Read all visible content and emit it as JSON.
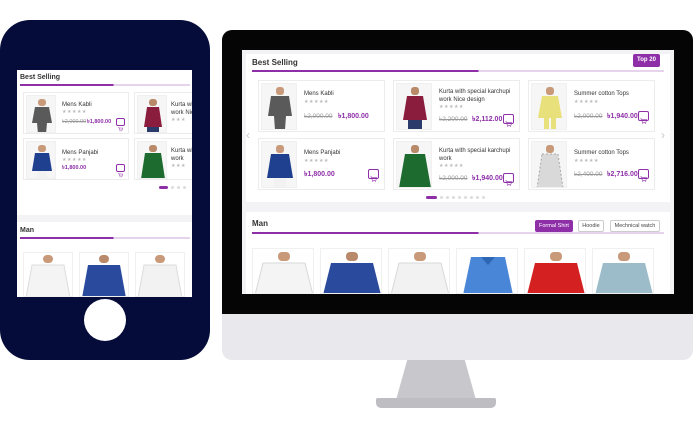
{
  "best_selling": {
    "title": "Best Selling",
    "badge": "Top 20",
    "currency": "৳",
    "cart_icon": "cart-icon",
    "star_icon": "star-icon",
    "products": [
      {
        "name": "Mens Kabli",
        "old_price": "৳2,000.00",
        "price": "৳1,800.00",
        "color": "#5a5a5a"
      },
      {
        "name": "Kurta with special karchupi work Nice design",
        "old_price": "৳2,200.00",
        "price": "৳2,112.00",
        "color": "#8a1c3d"
      },
      {
        "name": "Summer cotton Tops",
        "old_price": "৳2,000.00",
        "price": "৳1,940.00",
        "color": "#e8e07a"
      },
      {
        "name": "Mens Panjabi",
        "old_price": "",
        "price": "৳1,800.00",
        "color": "#1f3f8f"
      },
      {
        "name": "Kurta with special karchupi work",
        "old_price": "৳2,000.00",
        "price": "৳1,940.00",
        "color": "#1d6b2f"
      },
      {
        "name": "Summer cotton Tops",
        "old_price": "৳2,400.00",
        "price": "৳2,716.00",
        "color": "#d9d9d9"
      }
    ],
    "phone_products": [
      {
        "name": "Mens Kabli",
        "old_price": "৳2,000.00",
        "price": "৳1,800.00"
      },
      {
        "name": "Kurta wi work Nice",
        "old_price": "",
        "price": ""
      },
      {
        "name": "Mens Panjabi",
        "old_price": "",
        "price": "৳1,800.00"
      },
      {
        "name": "Kurta wi work",
        "old_price": "",
        "price": ""
      }
    ]
  },
  "man": {
    "title": "Man",
    "tabs": [
      "Formal Shirt",
      "Hoodie",
      "Mechnical watch"
    ],
    "shirt_colors": [
      "#f4f4f4",
      "#2a4a9e",
      "#f2f2f2",
      "#4a86d8",
      "#d42020",
      "#9bbcc8"
    ]
  }
}
